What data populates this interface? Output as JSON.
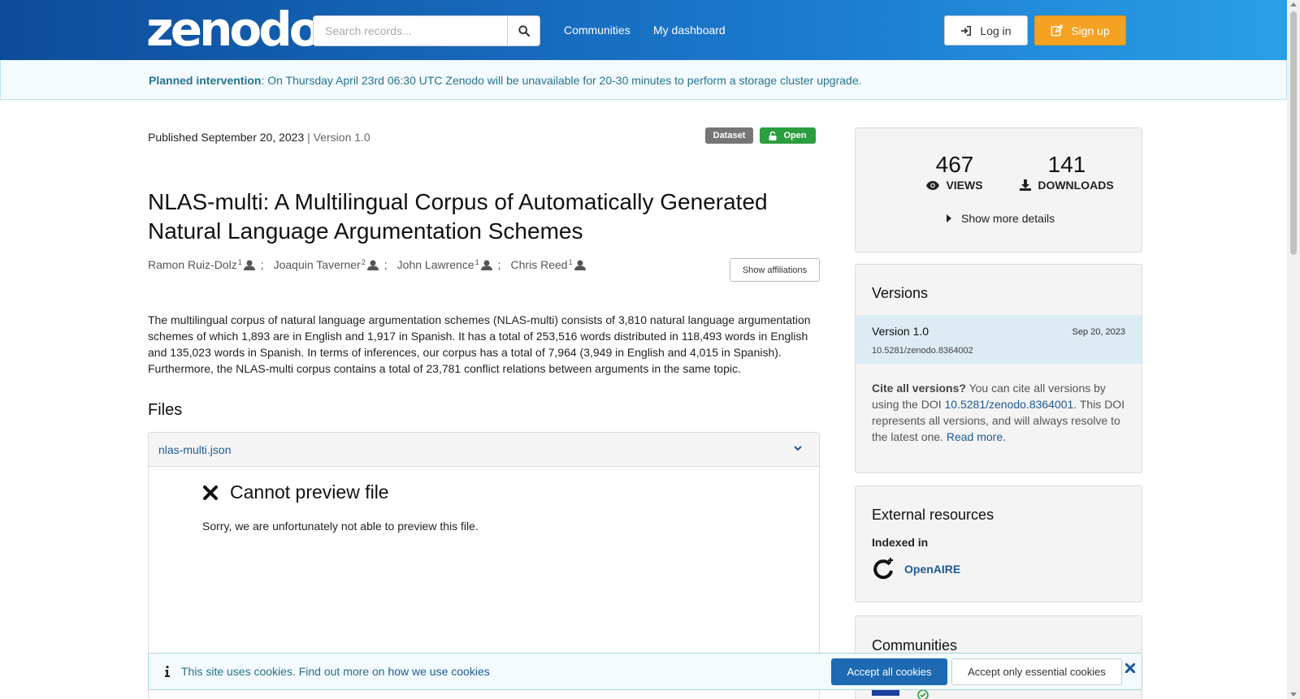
{
  "header": {
    "logo": "zenodo",
    "search_placeholder": "Search records...",
    "nav": [
      "Communities",
      "My dashboard"
    ],
    "login_label": "Log in",
    "signup_label": "Sign up"
  },
  "banner": {
    "bold": "Planned intervention",
    "text": ": On Thursday April 23rd 06:30 UTC Zenodo will be unavailable for 20-30 minutes to perform a storage cluster upgrade."
  },
  "record": {
    "published": "Published September 20, 2023",
    "version": "| Version 1.0",
    "type_label": "Dataset",
    "access_label": "Open",
    "title": "NLAS-multi: A Multilingual Corpus of Automatically Generated Natural Language Argumentation Schemes",
    "creators": [
      {
        "name": "Ramon Ruiz-Dolz",
        "aff": "1"
      },
      {
        "name": "Joaquin Taverner",
        "aff": "2"
      },
      {
        "name": "John Lawrence",
        "aff": "1"
      },
      {
        "name": "Chris Reed",
        "aff": "1"
      }
    ],
    "creator_sep": ";",
    "show_affiliations": "Show affiliations",
    "description": "The multilingual corpus of natural language argumentation schemes (NLAS-multi) consists of 3,810 natural language argumentation schemes of which 1,893 are in English and 1,917 in Spanish. It has a total of 253,516 words distributed in 118,493 words in English and 135,023 words in Spanish. In terms of inferences, our corpus has a total of 7,964 (3,949 in English and 4,015 in Spanish). Furthermore, the NLAS-multi corpus contains a total of 23,781 conflict relations between arguments in the same topic."
  },
  "files": {
    "heading": "Files",
    "file_name": "nlas-multi.json",
    "preview_title": "Cannot preview file",
    "preview_msg": "Sorry, we are unfortunately not able to preview this file."
  },
  "stats": {
    "views": "467",
    "views_label": "VIEWS",
    "downloads": "141",
    "downloads_label": "DOWNLOADS",
    "more_details": "Show more details"
  },
  "versions": {
    "heading": "Versions",
    "current_name": "Version 1.0",
    "current_date": "Sep 20, 2023",
    "current_doi": "10.5281/zenodo.8364002",
    "cite_bold": "Cite all versions?",
    "cite_text1": " You can cite all versions by using the DOI ",
    "cite_doi": "10.5281/zenodo.8364001",
    "cite_text2": ". This DOI represents all versions, and will always resolve to the latest one. ",
    "read_more": "Read more."
  },
  "external": {
    "heading": "External resources",
    "indexed_label": "Indexed in",
    "openaire": "OpenAIRE"
  },
  "communities": {
    "heading": "Communities"
  },
  "cookie": {
    "text": "This site uses cookies. Find out more on ",
    "link": "how we use cookies",
    "accept_all": "Accept all cookies",
    "accept_essential": "Accept only essential cookies"
  },
  "colors": {
    "header_start": "#0d4c9a",
    "header_end": "#2a9fe8",
    "signup": "#f5a122",
    "open_badge": "#2b9e3e",
    "link": "#1d5a96"
  }
}
